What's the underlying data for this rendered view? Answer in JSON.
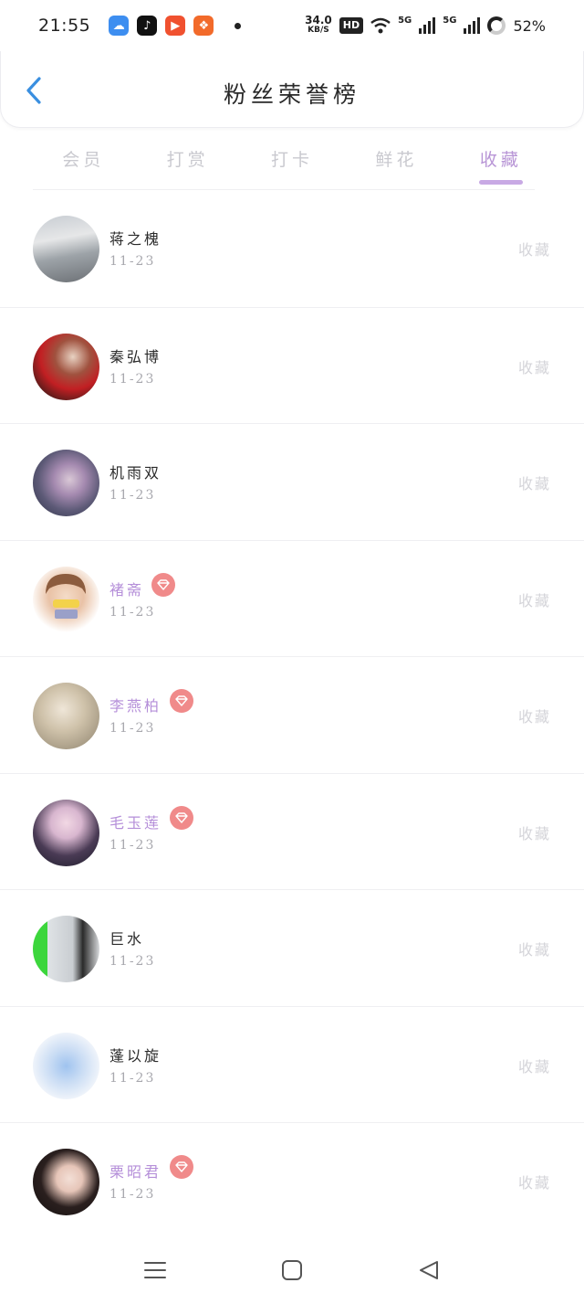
{
  "status_bar": {
    "time": "21:55",
    "net_speed": "34.0",
    "net_unit": "KB/S",
    "hd": "HD",
    "signal1": "5G",
    "signal2": "5G",
    "battery": "52%"
  },
  "header": {
    "title": "粉丝荣誉榜"
  },
  "tabs": [
    {
      "label": "会员",
      "active": false
    },
    {
      "label": "打赏",
      "active": false
    },
    {
      "label": "打卡",
      "active": false
    },
    {
      "label": "鲜花",
      "active": false
    },
    {
      "label": "收藏",
      "active": true
    }
  ],
  "colors": {
    "accent": "#b895d6",
    "badge": "#f08a8a",
    "back_arrow": "#3a8fe0"
  },
  "fans": [
    {
      "name": "蒋之槐",
      "date": "11-23",
      "action": "收藏",
      "vip": false
    },
    {
      "name": "秦弘博",
      "date": "11-23",
      "action": "收藏",
      "vip": false
    },
    {
      "name": "机雨双",
      "date": "11-23",
      "action": "收藏",
      "vip": false
    },
    {
      "name": "褚斋",
      "date": "11-23",
      "action": "收藏",
      "vip": true
    },
    {
      "name": "李燕柏",
      "date": "11-23",
      "action": "收藏",
      "vip": true
    },
    {
      "name": "毛玉莲",
      "date": "11-23",
      "action": "收藏",
      "vip": true
    },
    {
      "name": "巨水",
      "date": "11-23",
      "action": "收藏",
      "vip": false
    },
    {
      "name": "蓬以旋",
      "date": "11-23",
      "action": "收藏",
      "vip": false
    },
    {
      "name": "栗昭君",
      "date": "11-23",
      "action": "收藏",
      "vip": true
    }
  ],
  "icons": {
    "back": "chevron-left-icon",
    "vip_badge": "diamond-icon",
    "nav": [
      "menu-icon",
      "home-icon",
      "back-triangle-icon"
    ]
  }
}
